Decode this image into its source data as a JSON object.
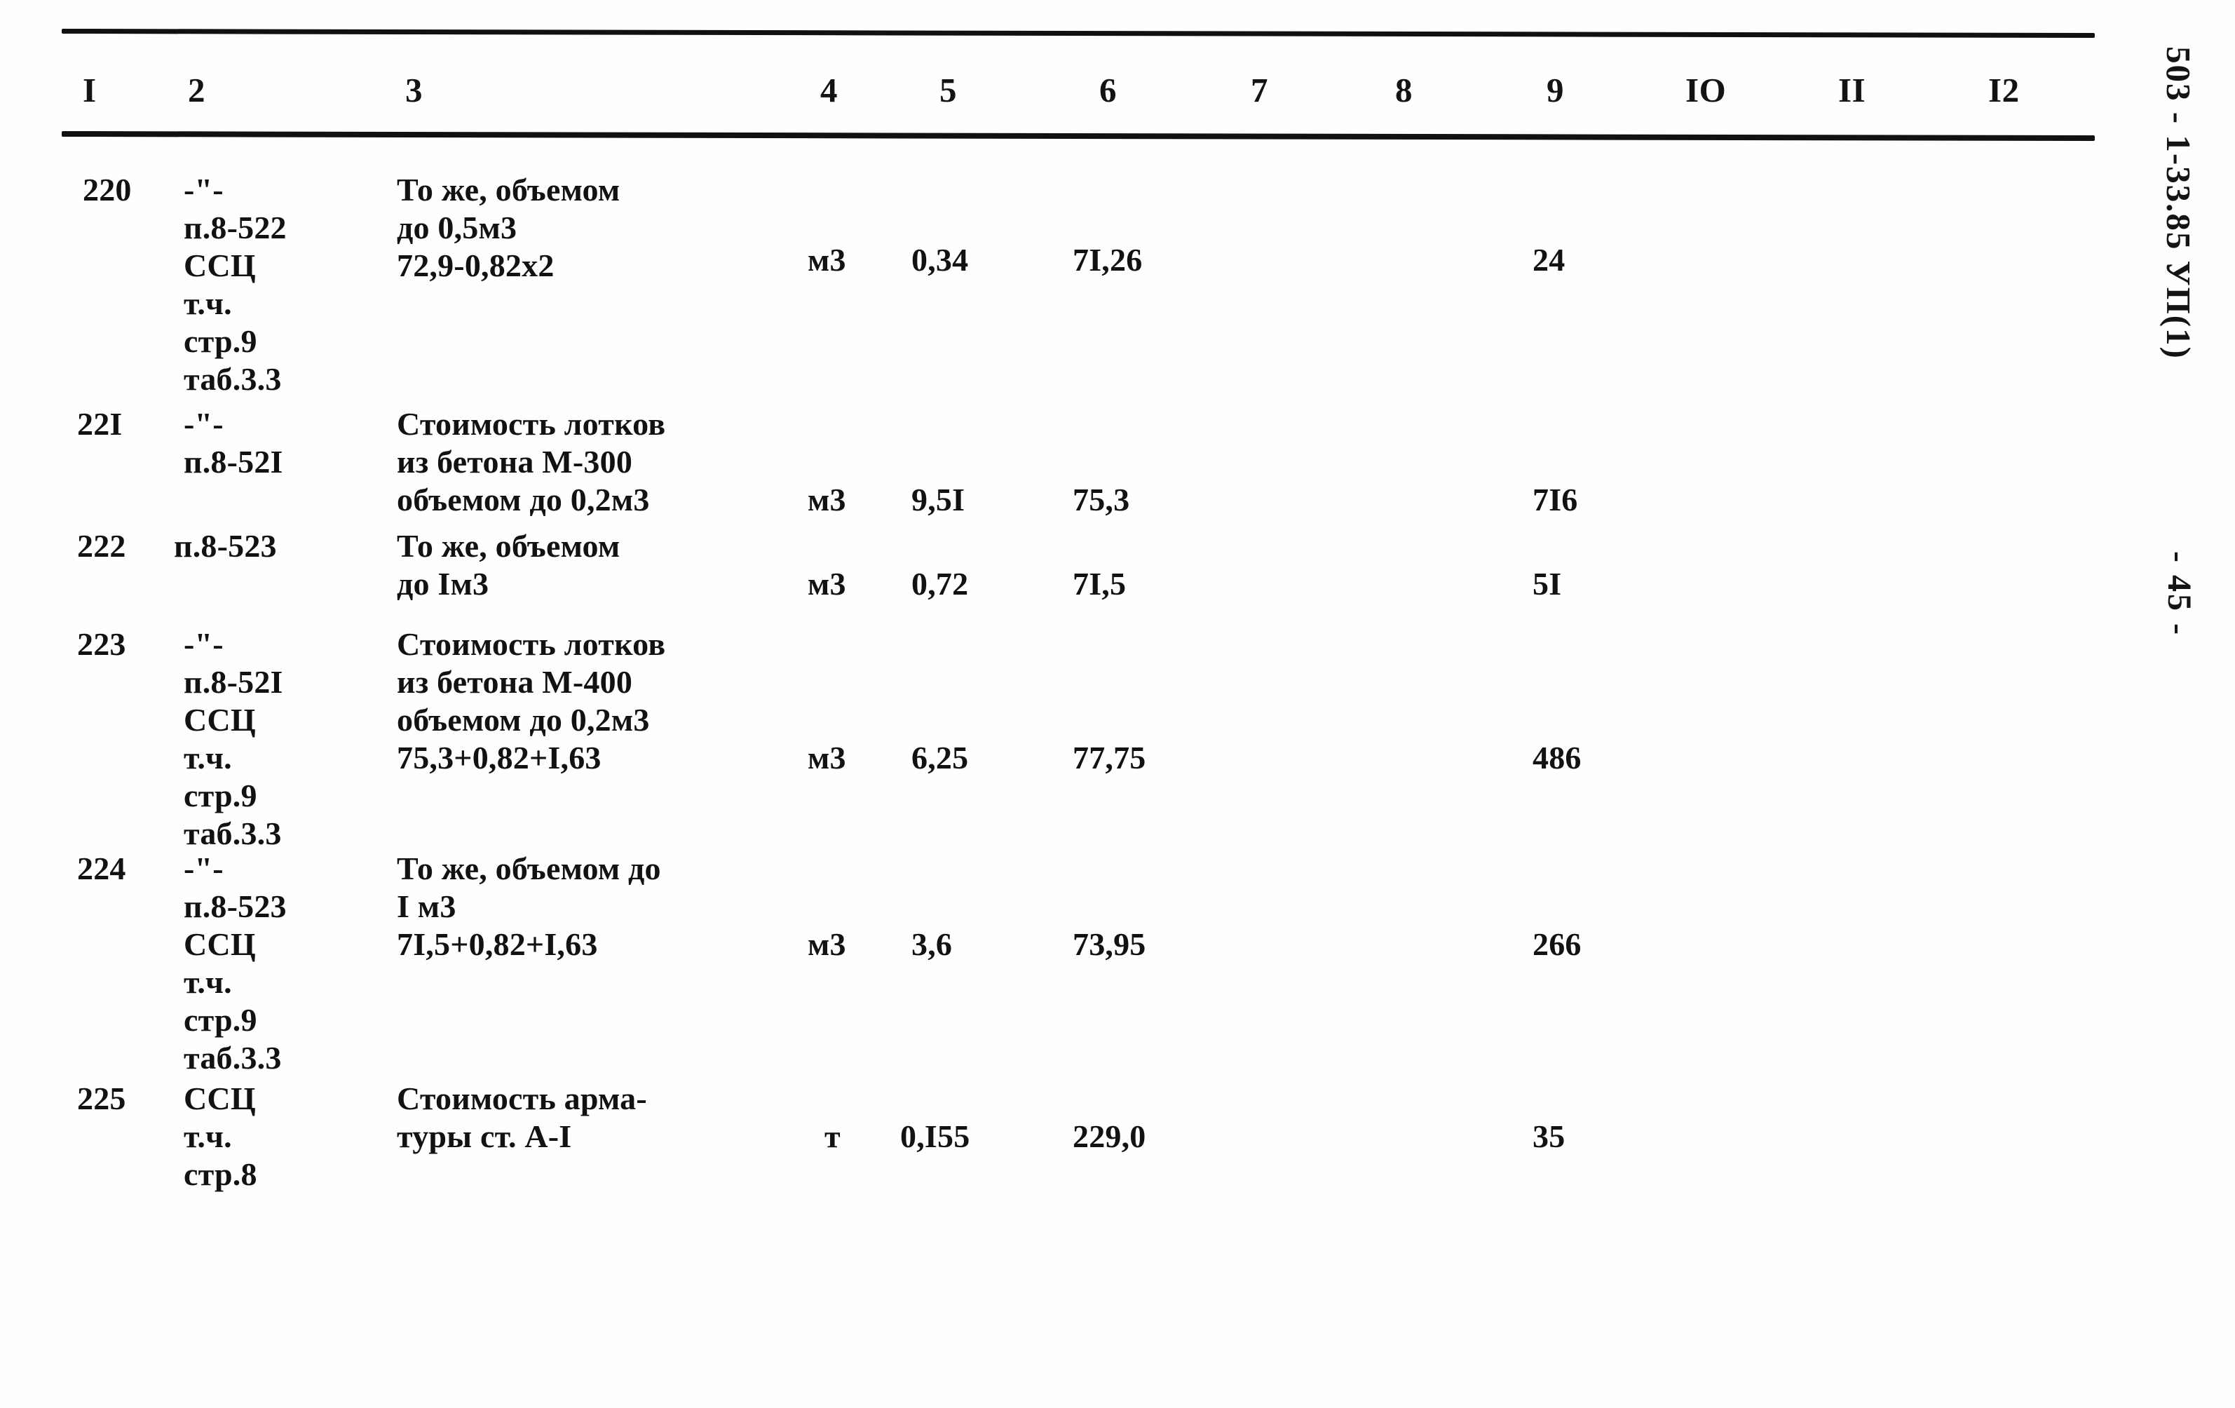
{
  "document": {
    "type": "estimate-table",
    "right_margin_code": "503 - 1-33.85  УП(1)",
    "page_label": "- 45 -"
  },
  "table": {
    "column_headers": [
      "I",
      "2",
      "3",
      "4",
      "5",
      "6",
      "7",
      "8",
      "9",
      "IO",
      "II",
      "I2"
    ],
    "rows": [
      {
        "no": "220",
        "justification": [
          "-\"-",
          "п.8-522",
          "ССЦ",
          "т.ч.",
          "стр.9",
          "таб.3.3"
        ],
        "description": [
          "То же, объемом",
          "до 0,5м3",
          "72,9-0,82х2"
        ],
        "unit": "м3",
        "qty": "0,34",
        "price": "7I,26",
        "col7": "",
        "col8": "",
        "total": "24",
        "col10": "",
        "col11": "",
        "col12": ""
      },
      {
        "no": "22I",
        "justification": [
          "-\"-",
          "п.8-52I"
        ],
        "description": [
          "Стоимость лотков",
          "из бетона М-300",
          "объемом до 0,2м3"
        ],
        "unit": "м3",
        "qty": "9,5I",
        "price": "75,3",
        "col7": "",
        "col8": "",
        "total": "7I6",
        "col10": "",
        "col11": "",
        "col12": ""
      },
      {
        "no": "222",
        "justification": [
          "п.8-523"
        ],
        "description": [
          "То же, объемом",
          "до Iм3"
        ],
        "unit": "м3",
        "qty": "0,72",
        "price": "7I,5",
        "col7": "",
        "col8": "",
        "total": "5I",
        "col10": "",
        "col11": "",
        "col12": ""
      },
      {
        "no": "223",
        "justification": [
          "-\"-",
          "п.8-52I",
          "ССЦ",
          "т.ч.",
          "стр.9",
          "таб.3.3"
        ],
        "description": [
          "Стоимость лотков",
          "из бетона М-400",
          "объемом до 0,2м3",
          "75,3+0,82+I,63"
        ],
        "unit": "м3",
        "qty": "6,25",
        "price": "77,75",
        "col7": "",
        "col8": "",
        "total": "486",
        "col10": "",
        "col11": "",
        "col12": ""
      },
      {
        "no": "224",
        "justification": [
          "-\"-",
          "п.8-523",
          "ССЦ",
          "т.ч.",
          "стр.9",
          "таб.3.3"
        ],
        "description": [
          "То же, объемом до",
          "I м3",
          "7I,5+0,82+I,63"
        ],
        "unit": "м3",
        "qty": "3,6",
        "price": "73,95",
        "col7": "",
        "col8": "",
        "total": "266",
        "col10": "",
        "col11": "",
        "col12": ""
      },
      {
        "no": "225",
        "justification": [
          "ССЦ",
          "т.ч.",
          "стр.8"
        ],
        "description": [
          "Стоимость арма-",
          "туры ст. А-I"
        ],
        "unit": "т",
        "qty": "0,I55",
        "price": "229,0",
        "col7": "",
        "col8": "",
        "total": "35",
        "col10": "",
        "col11": "",
        "col12": ""
      }
    ]
  }
}
